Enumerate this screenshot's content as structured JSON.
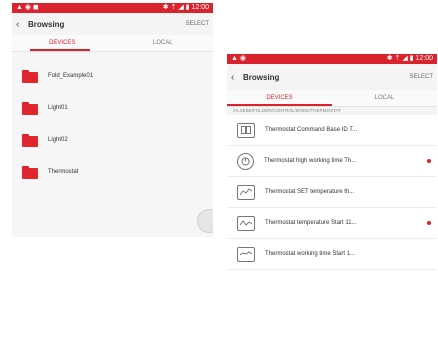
{
  "left": {
    "status_left": "▲ ◉ ◼",
    "status_right": "✱ ⇡ ◢ ▮ 12:00",
    "title": "Browsing",
    "select": "SELECT",
    "tabs": [
      "DEVICES",
      "LOCAL"
    ],
    "folders": [
      "Fold_Example01",
      "Light01",
      "Light02",
      "Thermostat"
    ]
  },
  "right": {
    "status_left": "▲ ◉",
    "status_right": "✱ ⇡ ◢ ▮ 12:00",
    "title": "Browsing",
    "select": "SELECT",
    "tabs": [
      "DEVICES",
      "LOCAL"
    ],
    "path": "/ALSEBE/FOLDER/CONTROL/MODE/THERMOSTAT",
    "files": [
      {
        "label": "Thermostat Command Base ID T...",
        "icon": "grid-icon",
        "unread": false
      },
      {
        "label": "Thermostat high working time Th...",
        "icon": "dial-icon",
        "unread": true
      },
      {
        "label": "Thermostat SET temperature th...",
        "icon": "graph-icon",
        "unread": false
      },
      {
        "label": "Thermostat temperature Start 11...",
        "icon": "graph-icon",
        "unread": true
      },
      {
        "label": "Thermostat working time Start 1...",
        "icon": "graph-icon",
        "unread": false
      }
    ]
  }
}
